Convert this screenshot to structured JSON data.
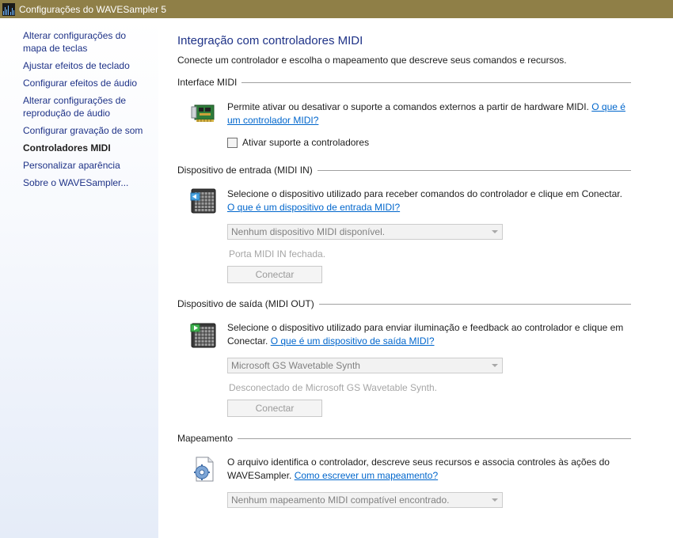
{
  "window": {
    "title": "Configurações do WAVESampler 5",
    "app_icon": "waveform-app-icon"
  },
  "sidebar": {
    "items": [
      {
        "label": "Alterar configurações do mapa de teclas"
      },
      {
        "label": "Ajustar efeitos de teclado"
      },
      {
        "label": "Configurar efeitos de áudio"
      },
      {
        "label": "Alterar configurações de reprodução de áudio"
      },
      {
        "label": "Configurar gravação de som"
      },
      {
        "label": "Controladores MIDI",
        "active": true
      },
      {
        "label": "Personalizar aparência"
      },
      {
        "label": "Sobre o WAVESampler..."
      }
    ]
  },
  "page": {
    "title": "Integração com controladores MIDI",
    "subtitle": "Conecte um controlador e escolha o mapeamento que descreve seus comandos e recursos."
  },
  "midi_interface": {
    "header": "Interface MIDI",
    "icon": "midi-card-icon",
    "description": "Permite ativar ou desativar o suporte a comandos externos a partir de hardware MIDI.",
    "link": "O que é um controlador MIDI?",
    "checkbox_label": "Ativar suporte a controladores",
    "checked": false
  },
  "midi_in": {
    "header": "Dispositivo de entrada (MIDI IN)",
    "icon": "launchpad-input-icon",
    "description": "Selecione o dispositivo utilizado para receber comandos do controlador e clique em Conectar.",
    "link": "O que é um dispositivo de entrada MIDI?",
    "select_value": "Nenhum dispositivo MIDI disponível.",
    "status": "Porta MIDI IN fechada.",
    "button": "Conectar"
  },
  "midi_out": {
    "header": "Dispositivo de saída (MIDI OUT)",
    "icon": "launchpad-output-icon",
    "description": "Selecione o dispositivo utilizado para enviar iluminação e feedback ao controlador e clique em Conectar.",
    "link": "O que é um dispositivo de saída MIDI?",
    "select_value": "Microsoft GS Wavetable Synth",
    "status": "Desconectado de Microsoft GS Wavetable Synth.",
    "button": "Conectar"
  },
  "mapping": {
    "header": "Mapeamento",
    "icon": "mapping-file-gear-icon",
    "description": "O arquivo identifica o controlador, descreve seus recursos e associa controles às ações do WAVESampler.",
    "link": "Como escrever um mapeamento?",
    "select_value": "Nenhum mapeamento MIDI compatível encontrado."
  },
  "colors": {
    "titlebar": "#8f7f47",
    "link": "#0066cc",
    "heading": "#1e3287"
  }
}
